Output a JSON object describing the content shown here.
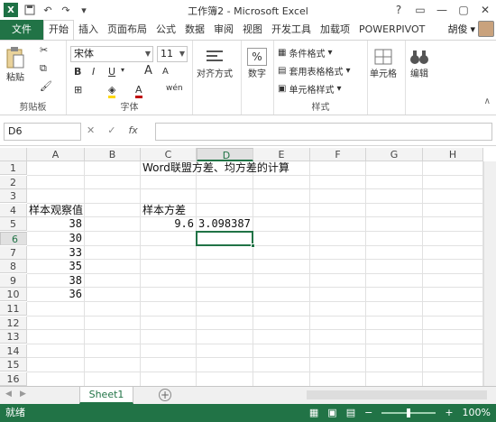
{
  "window": {
    "title": "工作簿2 - Microsoft Excel",
    "controls": [
      "?",
      "▭",
      "—",
      "▢",
      "✕"
    ]
  },
  "qat": {
    "save_icon": "save-icon",
    "undo_icon": "undo-icon",
    "redo_icon": "redo-icon"
  },
  "tabs": [
    {
      "label": "文件"
    },
    {
      "label": "开始"
    },
    {
      "label": "插入"
    },
    {
      "label": "页面布局"
    },
    {
      "label": "公式"
    },
    {
      "label": "数据"
    },
    {
      "label": "审阅"
    },
    {
      "label": "视图"
    },
    {
      "label": "开发工具"
    },
    {
      "label": "加载项"
    },
    {
      "label": "POWERPIVOT"
    }
  ],
  "account": {
    "name": "胡俊"
  },
  "ribbon": {
    "clipboard": {
      "paste": "粘贴",
      "group_label": "剪贴板"
    },
    "font": {
      "family": "宋体",
      "size": "11",
      "bold": "B",
      "italic": "I",
      "underline": "U",
      "grow": "A",
      "shrink": "A",
      "wen": "wén",
      "group_label": "字体"
    },
    "alignment": {
      "label": "对齐方式"
    },
    "number": {
      "label": "数字",
      "symbol": "%"
    },
    "styles": {
      "cond": "条件格式",
      "table": "套用表格格式",
      "cell": "单元格样式",
      "group_label": "样式"
    },
    "cells": {
      "label": "单元格"
    },
    "editing": {
      "label": "编辑"
    }
  },
  "formula_bar": {
    "name_box": "D6",
    "cancel": "✕",
    "enter": "✓",
    "fx": "fx",
    "content": ""
  },
  "grid": {
    "columns": [
      "A",
      "B",
      "C",
      "D",
      "E",
      "F",
      "G",
      "H"
    ],
    "rows": [
      "1",
      "2",
      "3",
      "4",
      "5",
      "6",
      "7",
      "8",
      "9",
      "10",
      "11",
      "12",
      "13",
      "14",
      "15",
      "16"
    ],
    "selected_column": "D",
    "selected_row": "6",
    "cells": {
      "C1": "Word联盟方差、均方差的计算",
      "A4": "样本观察值",
      "C4": "样本方差",
      "A5": "38",
      "C5": "9.6",
      "D5": "3.098387",
      "A6": "30",
      "A7": "33",
      "A8": "35",
      "A9": "38",
      "A10": "36"
    }
  },
  "sheets": {
    "active": "Sheet1",
    "add": "+"
  },
  "status": {
    "ready": "就绪",
    "zoom": "100%"
  }
}
